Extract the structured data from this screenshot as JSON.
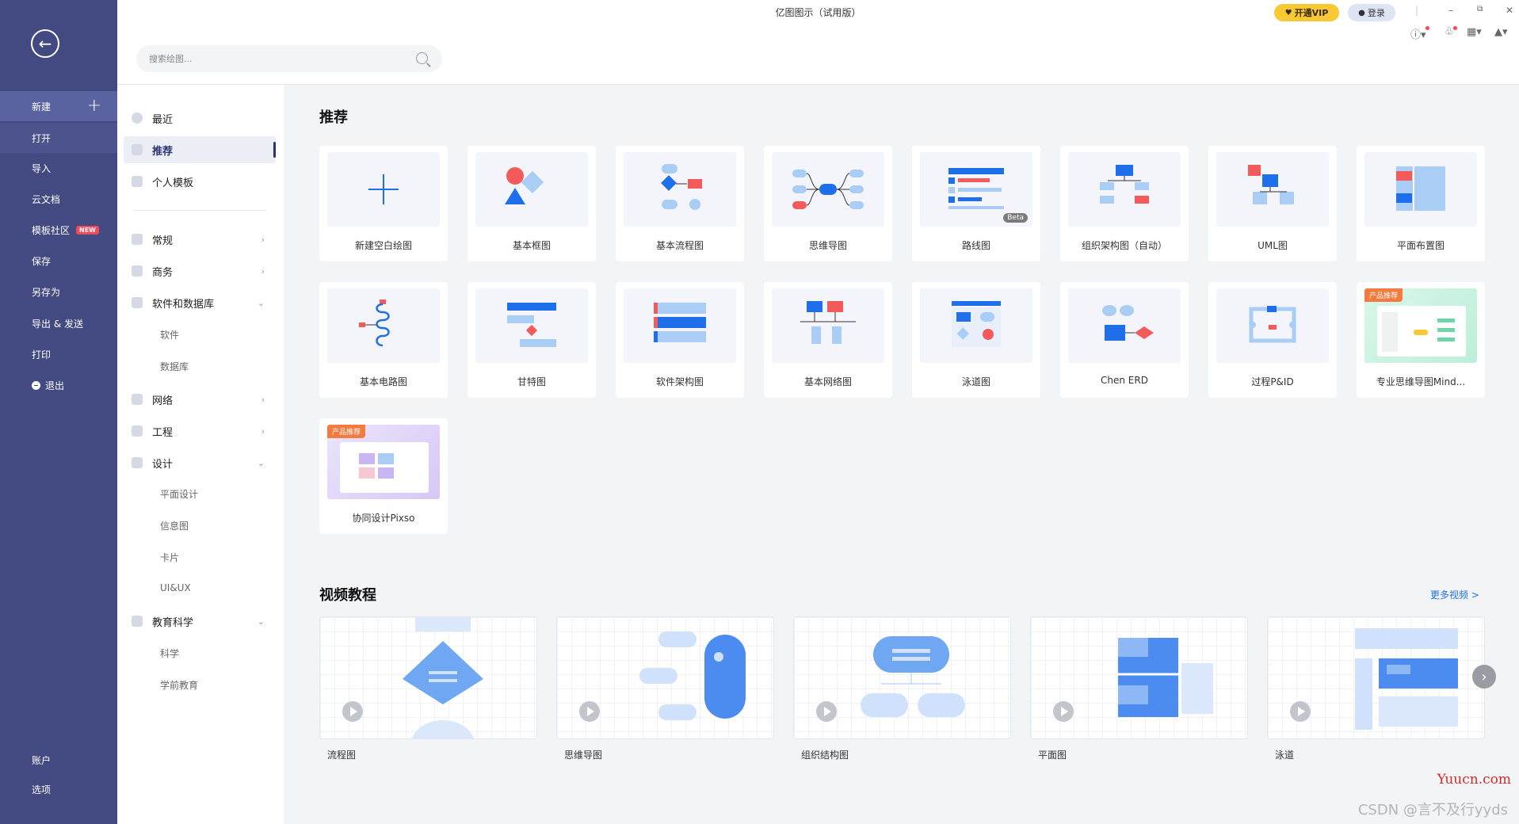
{
  "app": {
    "title": "亿图图示（试用版）"
  },
  "topbar": {
    "vip_label": "开通VIP",
    "login_label": "登录",
    "search_placeholder": "搜索绘图..."
  },
  "leftnav": {
    "items": [
      {
        "label": "新建"
      },
      {
        "label": "打开"
      },
      {
        "label": "导入"
      },
      {
        "label": "云文档"
      },
      {
        "label": "模板社区",
        "badge": "NEW"
      },
      {
        "label": "保存"
      },
      {
        "label": "另存为"
      },
      {
        "label": "导出 & 发送"
      },
      {
        "label": "打印"
      },
      {
        "label": "退出"
      }
    ],
    "bottom": [
      {
        "label": "账户"
      },
      {
        "label": "选项"
      }
    ]
  },
  "categories": {
    "top": [
      {
        "label": "最近"
      },
      {
        "label": "推荐"
      },
      {
        "label": "个人模板"
      }
    ],
    "groups": [
      {
        "label": "常规"
      },
      {
        "label": "商务"
      },
      {
        "label": "软件和数据库"
      },
      {
        "label": "网络"
      },
      {
        "label": "工程"
      },
      {
        "label": "设计"
      },
      {
        "label": "教育科学"
      }
    ],
    "subs": {
      "software": [
        "软件",
        "数据库"
      ],
      "design": [
        "平面设计",
        "信息图",
        "卡片",
        "UI&UX"
      ],
      "edu": [
        "科学",
        "学前教育"
      ]
    }
  },
  "recommend": {
    "title": "推荐",
    "cards": [
      {
        "label": "新建空白绘图"
      },
      {
        "label": "基本框图"
      },
      {
        "label": "基本流程图"
      },
      {
        "label": "思维导图"
      },
      {
        "label": "路线图",
        "tag": "Beta"
      },
      {
        "label": "组织架构图（自动）"
      },
      {
        "label": "UML图"
      },
      {
        "label": "平面布置图"
      },
      {
        "label": "基本电路图"
      },
      {
        "label": "甘特图"
      },
      {
        "label": "软件架构图"
      },
      {
        "label": "基本网络图"
      },
      {
        "label": "泳道图"
      },
      {
        "label": "Chen ERD"
      },
      {
        "label": "过程P&ID"
      },
      {
        "label": "专业思维导图Mind...",
        "tag": "产品推荐"
      },
      {
        "label": "协同设计Pixso",
        "tag": "产品推荐"
      }
    ]
  },
  "videos": {
    "title": "视频教程",
    "more_label": "更多视频 >",
    "items": [
      {
        "label": "流程图"
      },
      {
        "label": "思维导图"
      },
      {
        "label": "组织结构图"
      },
      {
        "label": "平面图"
      },
      {
        "label": "泳道"
      }
    ]
  },
  "watermark": {
    "site": "Yuucn.com",
    "author": "CSDN @言不及行yyds"
  },
  "colors": {
    "nav_bg": "#434a82",
    "accent_blue": "#1f6fea",
    "vip_yellow": "#f9c835",
    "promo_orange": "#f47b3f"
  }
}
